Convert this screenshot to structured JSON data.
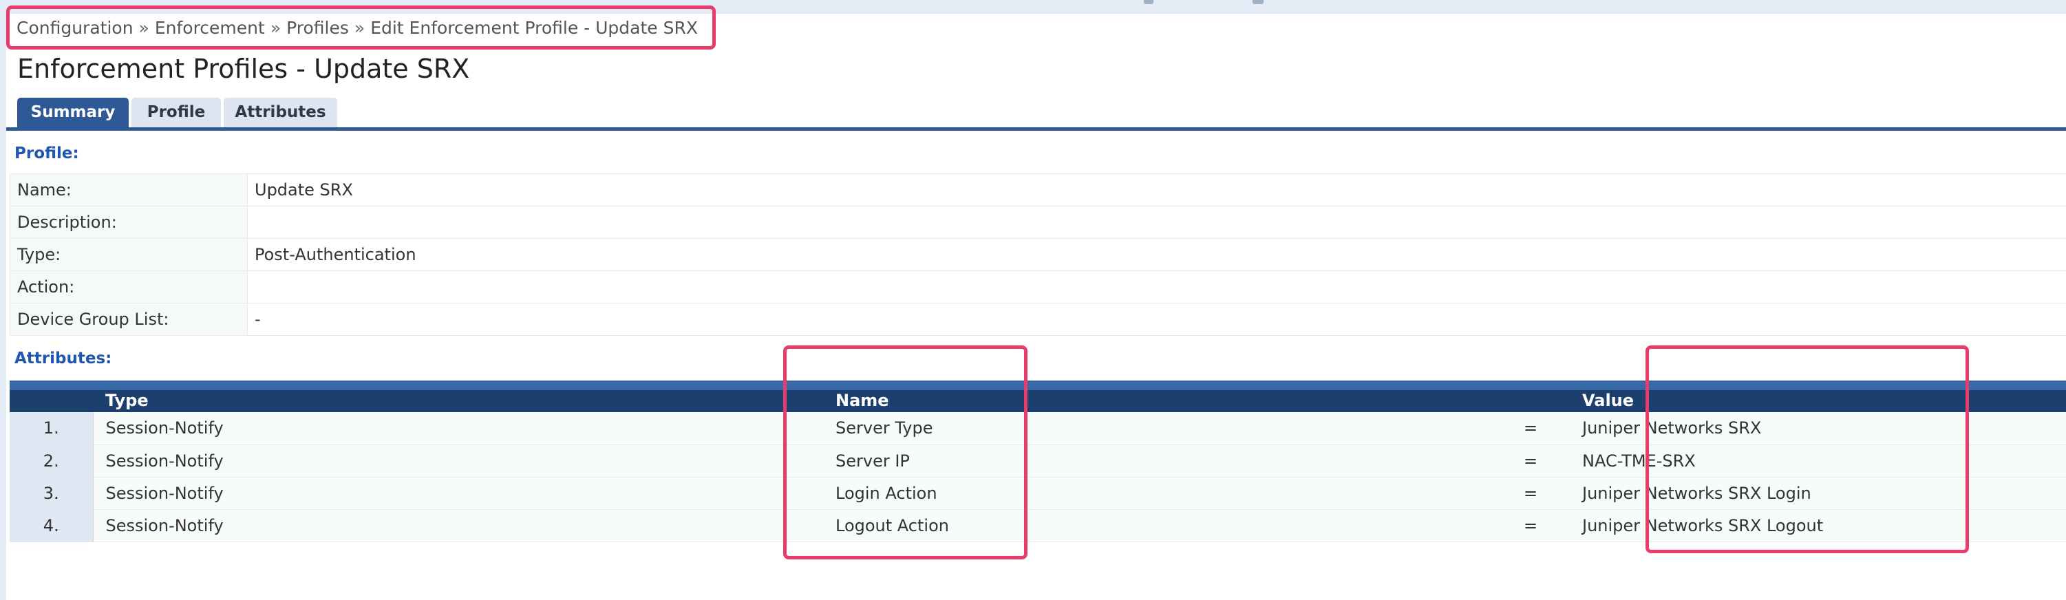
{
  "breadcrumb": {
    "items": [
      "Configuration",
      "Enforcement",
      "Profiles"
    ],
    "separator": "»",
    "current": "Edit Enforcement Profile - Update SRX"
  },
  "page_title": "Enforcement Profiles - Update SRX",
  "tabs": [
    {
      "label": "Summary",
      "active": true
    },
    {
      "label": "Profile",
      "active": false
    },
    {
      "label": "Attributes",
      "active": false
    }
  ],
  "profile_section": {
    "heading": "Profile:",
    "rows": [
      {
        "label": "Name:",
        "value": "Update SRX"
      },
      {
        "label": "Description:",
        "value": ""
      },
      {
        "label": "Type:",
        "value": "Post-Authentication"
      },
      {
        "label": "Action:",
        "value": ""
      },
      {
        "label": "Device Group List:",
        "value": "-"
      }
    ]
  },
  "attributes_section": {
    "heading": "Attributes:",
    "columns": {
      "type": "Type",
      "name": "Name",
      "value": "Value"
    },
    "rows": [
      {
        "num": "1.",
        "type": "Session-Notify",
        "name": "Server Type",
        "op": "=",
        "value": "Juniper Networks SRX"
      },
      {
        "num": "2.",
        "type": "Session-Notify",
        "name": "Server IP",
        "op": "=",
        "value": "NAC-TME-SRX"
      },
      {
        "num": "3.",
        "type": "Session-Notify",
        "name": "Login Action",
        "op": "=",
        "value": "Juniper Networks SRX Login"
      },
      {
        "num": "4.",
        "type": "Session-Notify",
        "name": "Logout Action",
        "op": "=",
        "value": "Juniper Networks SRX Logout"
      }
    ]
  },
  "colors": {
    "accent": "#2f5996",
    "section_heading": "#1f56b0",
    "table_header": "#1d3f6e",
    "highlight": "#ea3c6a"
  }
}
